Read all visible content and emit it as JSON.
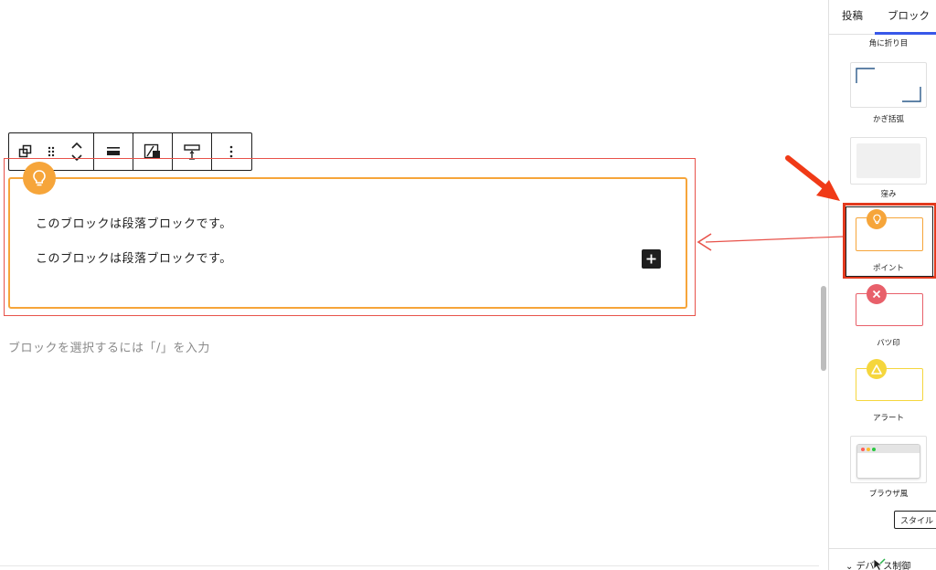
{
  "sidebar": {
    "tabs": [
      {
        "label": "投稿"
      },
      {
        "label": "ブロック"
      }
    ],
    "styles": {
      "folded_corner": "角に折り目",
      "brackets": "かぎ括弧",
      "inset": "窪み",
      "point": "ポイント",
      "cross": "バツ印",
      "alert": "アラート",
      "browser": "ブラウザ風"
    },
    "style_button": "スタイル",
    "bottom_section": "デバイス制御"
  },
  "editor": {
    "paragraph_1": "このブロックは段落ブロックです。",
    "paragraph_2": "このブロックは段落ブロックです。",
    "placeholder": "ブロックを選択するには「/」を入力"
  },
  "colors": {
    "point": "#f6a53a",
    "cross": "#e8606a",
    "alert": "#f5d63d",
    "highlight": "#e23a1e",
    "accent": "#3858e9"
  },
  "icons": {
    "toolbar": [
      "duplicate-icon",
      "drag-handle-icon",
      "move-up-down-icon",
      "align-icon",
      "text-color-icon",
      "spacing-icon",
      "more-options-icon"
    ],
    "add": "plus-icon",
    "point": "lightbulb-icon"
  }
}
